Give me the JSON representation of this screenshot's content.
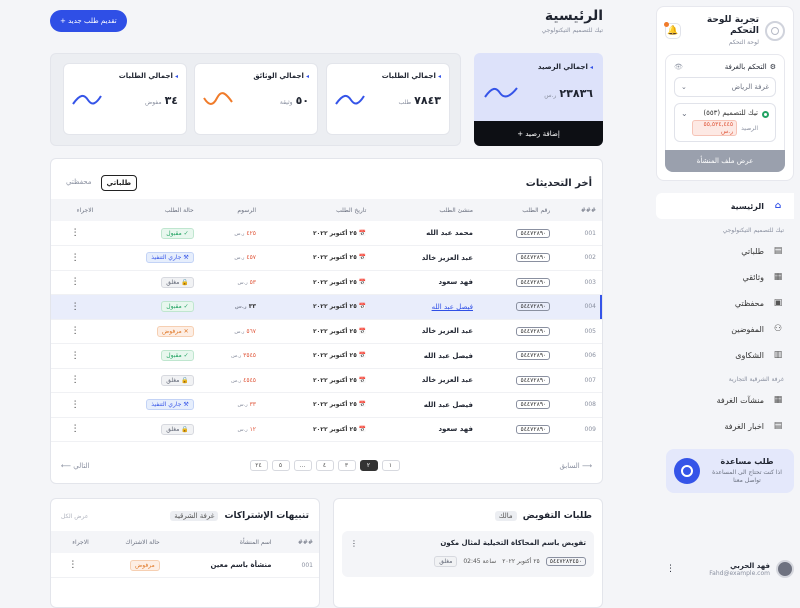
{
  "sidebar": {
    "brand_title": "تجربة للوحة التحكم",
    "brand_sub": "لوحة التحكم",
    "room_control_label": "التحكم بالغرفة",
    "room_select": "غرفة الرياض",
    "company_name": "تيك للتصميم (٥٥٣)",
    "balance_label": "الرصيد",
    "balance_value": "٥٥,٥٣٤,٤٤٥ ر.س",
    "facility_button": "عرض ملف المنشأة",
    "nav_home": "الرئيسية",
    "section_company": "تيك للتصميم التيكنولوجي",
    "nav_items": [
      "طلباتي",
      "وثائقي",
      "محفظتي",
      "المفوضين",
      "الشكاوى"
    ],
    "section_chamber": "غرفة الشرقية التجارية",
    "nav_items2": [
      "منشآت الغرفة",
      "اخبار الغرفة"
    ],
    "help_title": "طلب مساعدة",
    "help_desc": "اذا كنت تحتاج الى المساعدة تواصل معنا",
    "user_name": "فهد الحربي",
    "user_email": "Fahd@example.com"
  },
  "header": {
    "title": "الرئيسية",
    "subtitle": "تيك للتصميم التيكنولوجي",
    "new_button": "+ تقديم طلب جديد"
  },
  "stats": [
    {
      "title": "اجمالي الطلبات",
      "value": "٧٨٤٣",
      "unit": "طلب",
      "color": "#3554e8"
    },
    {
      "title": "اجمالي الوثائق",
      "value": "٥٠",
      "unit": "وثيقة",
      "color": "#f07b2a"
    },
    {
      "title": "اجمالي الطلبات",
      "value": "٣٤",
      "unit": "مفوض",
      "color": "#3554e8"
    }
  ],
  "balance_card": {
    "title": "اجمالي الرصيد",
    "value": "٢٣٨٣٦",
    "unit": "ر.س",
    "button": "+ إضافة رصيد"
  },
  "updates": {
    "title": "أخر التحديثات",
    "tabs": [
      "طلباتي",
      "محفظتي"
    ],
    "columns": [
      "###",
      "رقم الطلب",
      "منشئ الطلب",
      "تاريخ الطلب",
      "الرسوم",
      "حالة الطلب",
      "الاجراء"
    ],
    "rows": [
      {
        "num": "001",
        "ref": "٥٤٤٧٢٨٩٠",
        "name": "محمد عبد الله",
        "date": "٢٥ أكتوبر ٢٠٢٢",
        "fee": "٤٢٥",
        "status": "مقبول",
        "status_type": "ok"
      },
      {
        "num": "002",
        "ref": "٥٤٤٧٢٨٩٠",
        "name": "عبد العزيز خالد",
        "date": "٢٥ أكتوبر ٢٠٢٢",
        "fee": "٤٥٧",
        "status": "جاري التنفيذ",
        "status_type": "prog"
      },
      {
        "num": "003",
        "ref": "٥٤٤٧٢٨٩٠",
        "name": "فهد سعود",
        "date": "٢٥ أكتوبر ٢٠٢٢",
        "fee": "٥٣",
        "status": "مغلق",
        "status_type": "closed"
      },
      {
        "num": "004",
        "ref": "٥٤٤٧٢٨٩٠",
        "name": "فيصل عبد الله",
        "date": "٢٥ أكتوبر ٢٠٢٢",
        "fee": "٣٣",
        "status": "مقبول",
        "status_type": "ok"
      },
      {
        "num": "005",
        "ref": "٥٤٤٧٢٨٩٠",
        "name": "عبد العزيز خالد",
        "date": "٢٥ أكتوبر ٢٠٢٢",
        "fee": "٥٦٧",
        "status": "مرفوض",
        "status_type": "rej"
      },
      {
        "num": "006",
        "ref": "٥٤٤٧٢٨٩٠",
        "name": "فيصل عبد الله",
        "date": "٢٥ أكتوبر ٢٠٢٢",
        "fee": "٣٥٤٥",
        "status": "مقبول",
        "status_type": "ok"
      },
      {
        "num": "007",
        "ref": "٥٤٤٧٢٨٩٠",
        "name": "عبد العزيز خالد",
        "date": "٢٥ أكتوبر ٢٠٢٢",
        "fee": "٤٥٤٥",
        "status": "مغلق",
        "status_type": "closed"
      },
      {
        "num": "008",
        "ref": "٥٤٤٧٢٨٩٠",
        "name": "فيصل عبد الله",
        "date": "٢٥ أكتوبر ٢٠٢٢",
        "fee": "٣٣",
        "status": "جاري التنفيذ",
        "status_type": "prog"
      },
      {
        "num": "009",
        "ref": "٥٤٤٧٢٨٩٠",
        "name": "فهد سعود",
        "date": "٢٥ أكتوبر ٢٠٢٢",
        "fee": "١٢",
        "status": "مغلق",
        "status_type": "closed"
      }
    ],
    "currency": "ر.س",
    "prev": "السابق",
    "next": "التالي",
    "pages": [
      "١",
      "٢",
      "٣",
      "٤",
      "...",
      "٥",
      "٢٤"
    ]
  },
  "subscriptions": {
    "title": "تنبيهات الإشتراكات",
    "chip": "غرفة الشرقية",
    "view_all": "عرض الكل",
    "columns": [
      "###",
      "اسم المنشأة",
      "حالة الاشتراك",
      "الاجراء"
    ],
    "row": {
      "num": "001",
      "name": "منشأة باسم معين",
      "status": "مرفوض"
    }
  },
  "delegations": {
    "title": "طلبات التفويض",
    "chip": "مالك",
    "item_title": "تفويض باسم المحاكاة التخيلية لمثال مكون",
    "item_ref": "٥٤٤٧٢٨٣٤٥٠",
    "item_date": "٢٥ أكتوبر ٢٠٢٢",
    "item_time": "02:45 ساعة",
    "item_status": "مغلق"
  }
}
